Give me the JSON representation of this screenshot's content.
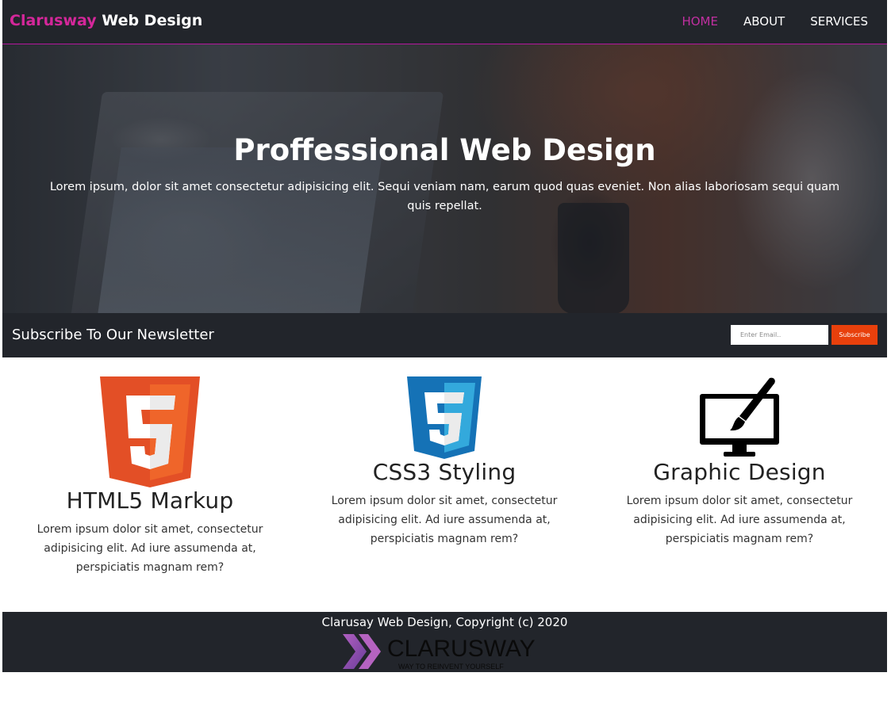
{
  "header": {
    "brand_accent": "Clarusway",
    "brand_rest": "Web Design",
    "nav": [
      "HOME",
      "ABOUT",
      "SERVICES"
    ]
  },
  "hero": {
    "title": "Proffessional Web Design",
    "text": "Lorem ipsum, dolor sit amet consectetur adipisicing elit. Sequi veniam nam, earum quod quas eveniet. Non alias laboriosam sequi quam quis repellat."
  },
  "newsletter": {
    "title": "Subscribe To Our Newsletter",
    "email_placeholder": "Enter Email..",
    "button_label": "Subscribe"
  },
  "features": [
    {
      "icon": "html5-icon",
      "title": "HTML5 Markup",
      "text": "Lorem ipsum dolor sit amet, consectetur adipisicing elit. Ad iure assumenda at, perspiciatis magnam rem?"
    },
    {
      "icon": "css3-icon",
      "title": "CSS3 Styling",
      "text": "Lorem ipsum dolor sit amet, consectetur adipisicing elit. Ad iure assumenda at, perspiciatis magnam rem?"
    },
    {
      "icon": "monitor-brush-icon",
      "title": "Graphic Design",
      "text": "Lorem ipsum dolor sit amet, consectetur adipisicing elit. Ad iure assumenda at, perspiciatis magnam rem?"
    }
  ],
  "footer": {
    "copyright": "Clarusay Web Design, Copyright (c) 2020",
    "logo_text": "CLARUSWAY",
    "logo_tagline": "WAY TO REINVENT YOURSELF"
  },
  "colors": {
    "dark": "#22252b",
    "accent": "#d4279a",
    "subscribe": "#e8400c",
    "html5": "#e34f26",
    "css3": "#1572b6"
  }
}
